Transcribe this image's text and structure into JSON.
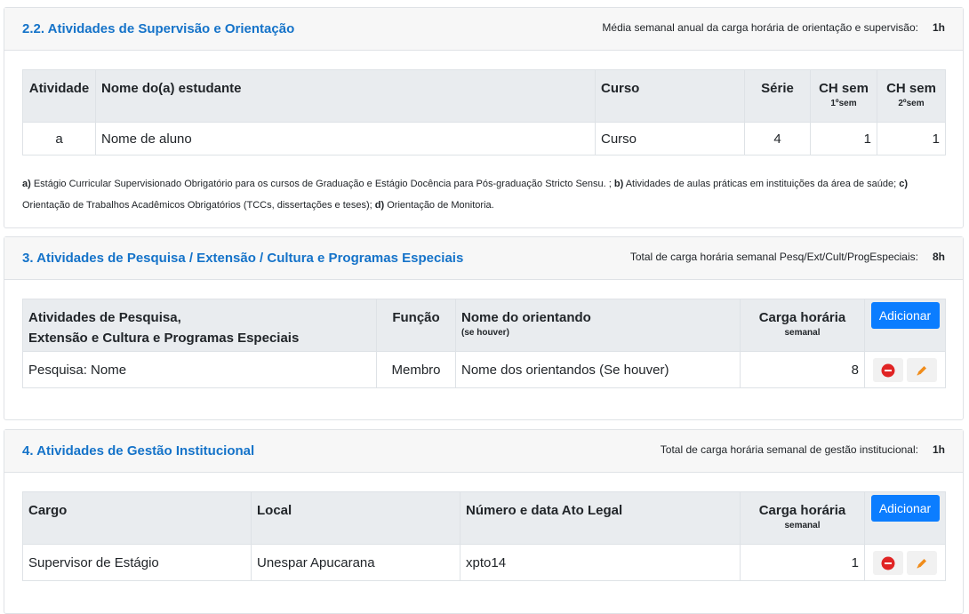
{
  "section22": {
    "title": "2.2. Atividades de Supervisão e Orientação",
    "summary_label": "Média semanal anual da carga horária de orientação e supervisão:",
    "summary_value": "1h",
    "headers": {
      "atividade": "Atividade",
      "nome": "Nome do(a) estudante",
      "curso": "Curso",
      "serie": "Série",
      "ch1": "CH sem",
      "ch1_sub": "1ºsem",
      "ch2": "CH sem",
      "ch2_sub": "2ºsem"
    },
    "row": {
      "atividade": "a",
      "nome": "Nome de aluno",
      "curso": "Curso",
      "serie": "4",
      "ch1": "1",
      "ch2": "1"
    },
    "legend": {
      "a_key": "a)",
      "a_text": " Estágio Curricular Supervisionado Obrigatório para os cursos de Graduação e Estágio Docência para Pós-graduação Stricto Sensu. ; ",
      "b_key": "b)",
      "b_text": " Atividades de aulas práticas em instituições da área de saúde; ",
      "c_key": "c)",
      "c_text": " Orientação de Trabalhos Acadêmicos Obrigatórios (TCCs, dissertações e teses); ",
      "d_key": "d)",
      "d_text": " Orientação de Monitoria."
    }
  },
  "section3": {
    "title": "3. Atividades de Pesquisa / Extensão / Cultura e Programas Especiais",
    "summary_label": "Total de carga horária semanal Pesq/Ext/Cult/ProgEspeciais:",
    "summary_value": "8h",
    "headers": {
      "atividade_line1": "Atividades de Pesquisa,",
      "atividade_line2": "Extensão e Cultura e Programas Especiais",
      "funcao": "Função",
      "orientando": "Nome do orientando",
      "orientando_sub": "(se houver)",
      "carga": "Carga horária",
      "carga_sub": "semanal",
      "add_button": "Adicionar"
    },
    "row": {
      "atividade": "Pesquisa: Nome",
      "funcao": "Membro",
      "orientando": "Nome dos orientandos (Se houver)",
      "carga": "8"
    }
  },
  "section4": {
    "title": "4. Atividades de Gestão Institucional",
    "summary_label": "Total de carga horária semanal de gestão institucional:",
    "summary_value": "1h",
    "headers": {
      "cargo": "Cargo",
      "local": "Local",
      "ato": "Número e data Ato Legal",
      "carga": "Carga horária",
      "carga_sub": "semanal",
      "add_button": "Adicionar"
    },
    "row": {
      "cargo": "Supervisor de Estágio",
      "local": "Unespar Apucarana",
      "ato": "xpto14",
      "carga": "1"
    }
  },
  "icons": {
    "remove": "minus-circle-icon",
    "edit": "pencil-icon"
  },
  "colors": {
    "title": "#1573c9",
    "add_button": "#0b7dff",
    "remove_icon": "#e02424",
    "edit_icon": "#f08c1a"
  }
}
